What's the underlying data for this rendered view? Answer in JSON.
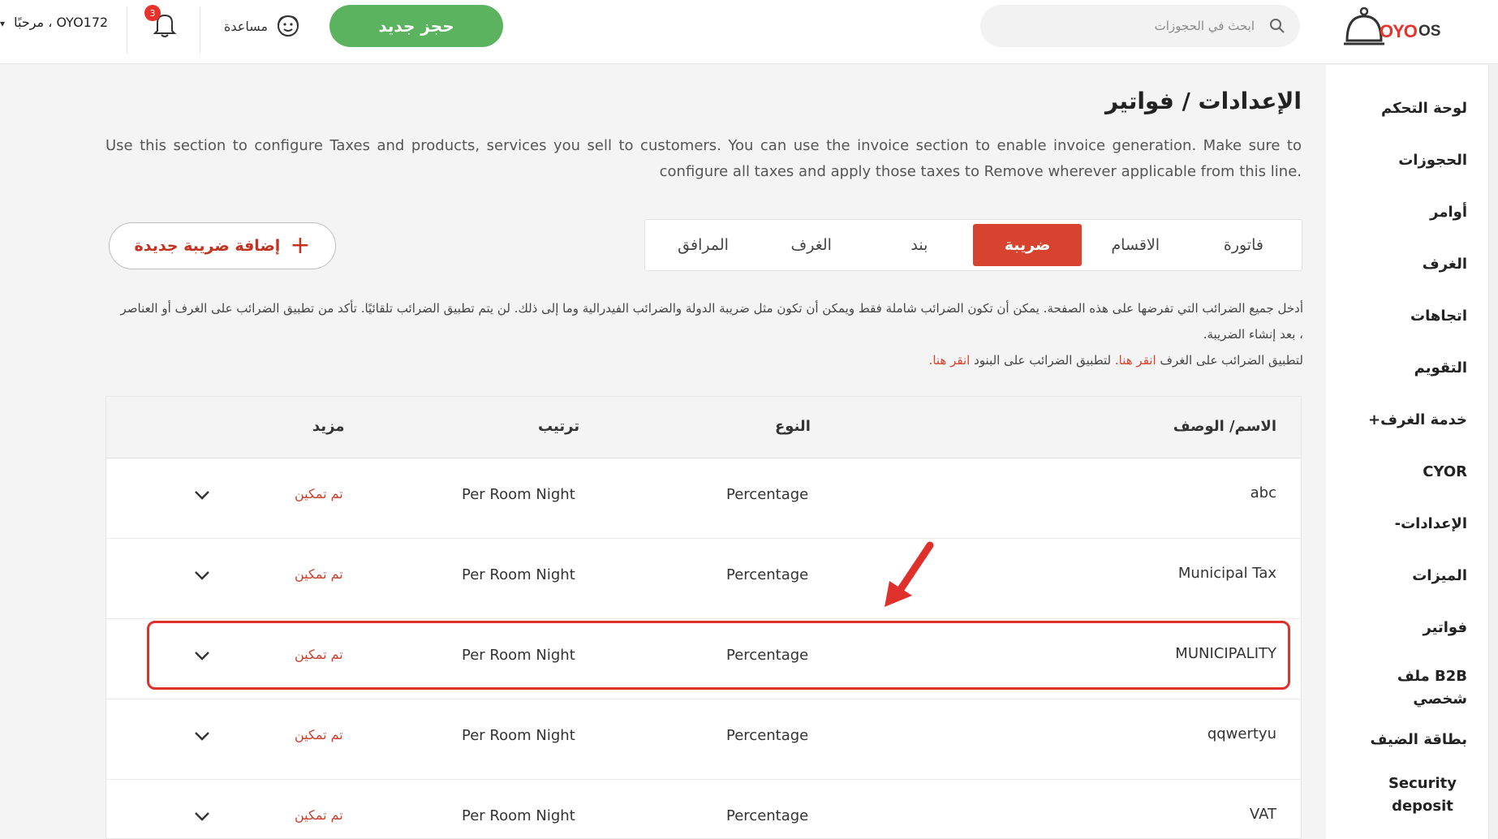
{
  "header": {
    "logo_word": "OYO",
    "logo_suffix": "OS",
    "search_placeholder": "ابحث في الحجوزات",
    "new_booking_label": "حجز جديد",
    "help_label": "مساعدة",
    "notification_count": "3",
    "greeting": "مرحبًا ، OYO172"
  },
  "sidebar": {
    "items": [
      {
        "label": "لوحة التحكم"
      },
      {
        "label": "الحجوزات"
      },
      {
        "label": "أوامر"
      },
      {
        "label": "الغرف"
      },
      {
        "label": "اتجاهات"
      },
      {
        "label": "التقويم"
      },
      {
        "label": "خدمة الغرف+"
      },
      {
        "label": "CYOR"
      },
      {
        "label": "الإعدادات-"
      },
      {
        "label": "الميزات"
      },
      {
        "label": "فواتير"
      },
      {
        "label": "B2B ملف شخصي"
      },
      {
        "label": "بطاقة الضيف"
      },
      {
        "label": "Security deposit"
      }
    ]
  },
  "main": {
    "title": "الإعدادات / فواتير",
    "intro": "Use this section to configure Taxes and products, services you sell to customers. You can use the invoice section to enable invoice generation. Make sure to configure all taxes and apply those taxes to Remove wherever applicable from this line.",
    "tabs": [
      {
        "label": "فاتورة",
        "active": false
      },
      {
        "label": "الاقسام",
        "active": false
      },
      {
        "label": "ضريبة",
        "active": true
      },
      {
        "label": "بند",
        "active": false
      },
      {
        "label": "الغرف",
        "active": false
      },
      {
        "label": "المرافق",
        "active": false
      }
    ],
    "add_tax_label": "إضافة ضريبة جديدة",
    "info_line1": "أدخل جميع الضرائب التي تفرضها على هذه الصفحة. يمكن أن تكون الضرائب شاملة فقط ويمكن أن تكون مثل ضريبة الدولة والضرائب الفيدرالية وما إلى ذلك. لن يتم تطبيق الضرائب تلقائيًا. تأكد من تطبيق الضرائب على الغرف أو العناصر ، بعد إنشاء الضريبة.",
    "info_rooms_prefix": "لتطبيق الضرائب على الغرف",
    "info_rooms_link": "انقر هنا.",
    "info_items_prefix": "لتطبيق الضرائب على البنود",
    "info_items_link": "انقر هنا."
  },
  "table": {
    "headers": {
      "name": "الاسم/ الوصف",
      "type": "النوع",
      "order": "ترتيب",
      "more": "مزيد"
    },
    "rows": [
      {
        "name": "abc",
        "type": "Percentage",
        "order": "Per Room Night",
        "status": "تم تمكين"
      },
      {
        "name": "Municipal Tax",
        "type": "Percentage",
        "order": "Per Room Night",
        "status": "تم تمكين"
      },
      {
        "name": "MUNICIPALITY",
        "type": "Percentage",
        "order": "Per Room Night",
        "status": "تم تمكين"
      },
      {
        "name": "qqwertyu",
        "type": "Percentage",
        "order": "Per Room Night",
        "status": "تم تمكين"
      },
      {
        "name": "VAT",
        "type": "Percentage",
        "order": "Per Room Night",
        "status": "تم تمكين"
      }
    ]
  },
  "colors": {
    "brand_red": "#e8322b",
    "active_tab": "#d8432f",
    "primary_green": "#5bb35f",
    "status_red": "#c9402e"
  }
}
